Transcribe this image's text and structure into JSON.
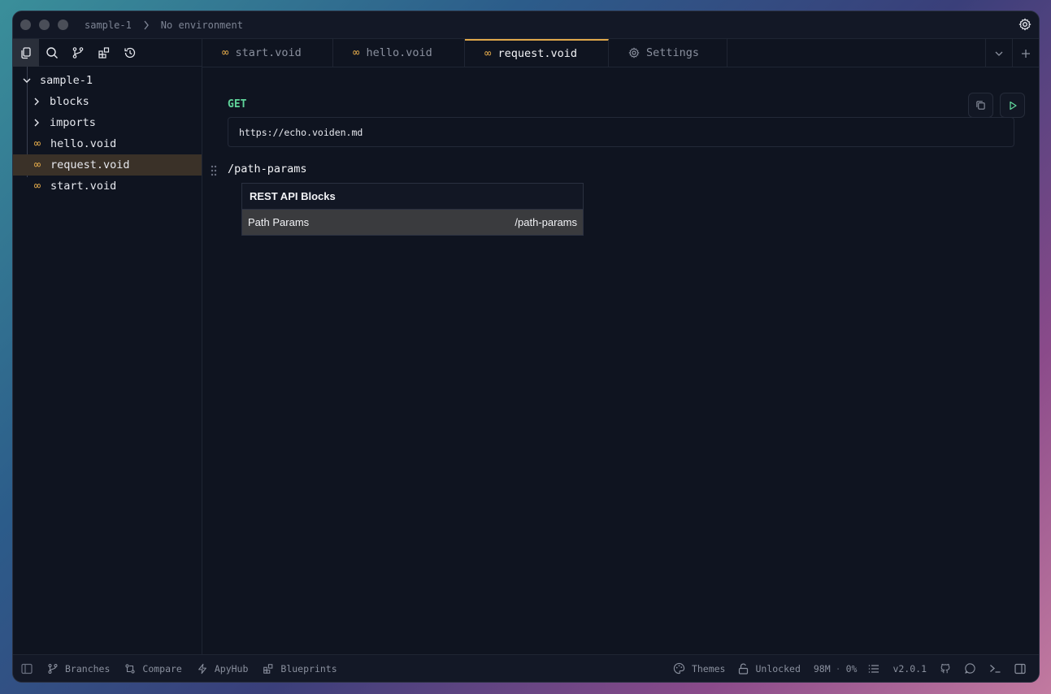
{
  "titlebar": {
    "project": "sample-1",
    "environment": "No environment"
  },
  "sidebar": {
    "tree": {
      "root": "sample-1",
      "items": [
        {
          "label": "blocks",
          "type": "folder"
        },
        {
          "label": "imports",
          "type": "folder"
        },
        {
          "label": "hello.void",
          "type": "file"
        },
        {
          "label": "request.void",
          "type": "file",
          "selected": true
        },
        {
          "label": "start.void",
          "type": "file"
        }
      ]
    }
  },
  "tabs": [
    {
      "label": "start.void",
      "icon": "infinity-icon"
    },
    {
      "label": "hello.void",
      "icon": "infinity-icon"
    },
    {
      "label": "request.void",
      "icon": "infinity-icon",
      "active": true
    },
    {
      "label": "Settings",
      "icon": "gear-icon"
    }
  ],
  "editor": {
    "method": "GET",
    "url": "https://echo.voiden.md",
    "slash_command": "/path-params",
    "popup": {
      "heading": "REST API Blocks",
      "item_label": "Path Params",
      "item_shortcut": "/path-params"
    }
  },
  "statusbar": {
    "branches": "Branches",
    "compare": "Compare",
    "apyhub": "ApyHub",
    "blueprints": "Blueprints",
    "themes": "Themes",
    "lock": "Unlocked",
    "memory": "98M",
    "cpu": "0%",
    "version": "v2.0.1"
  },
  "colors": {
    "accent": "#e0a84a",
    "method_get": "#5fd49a",
    "background": "#0f1420"
  }
}
